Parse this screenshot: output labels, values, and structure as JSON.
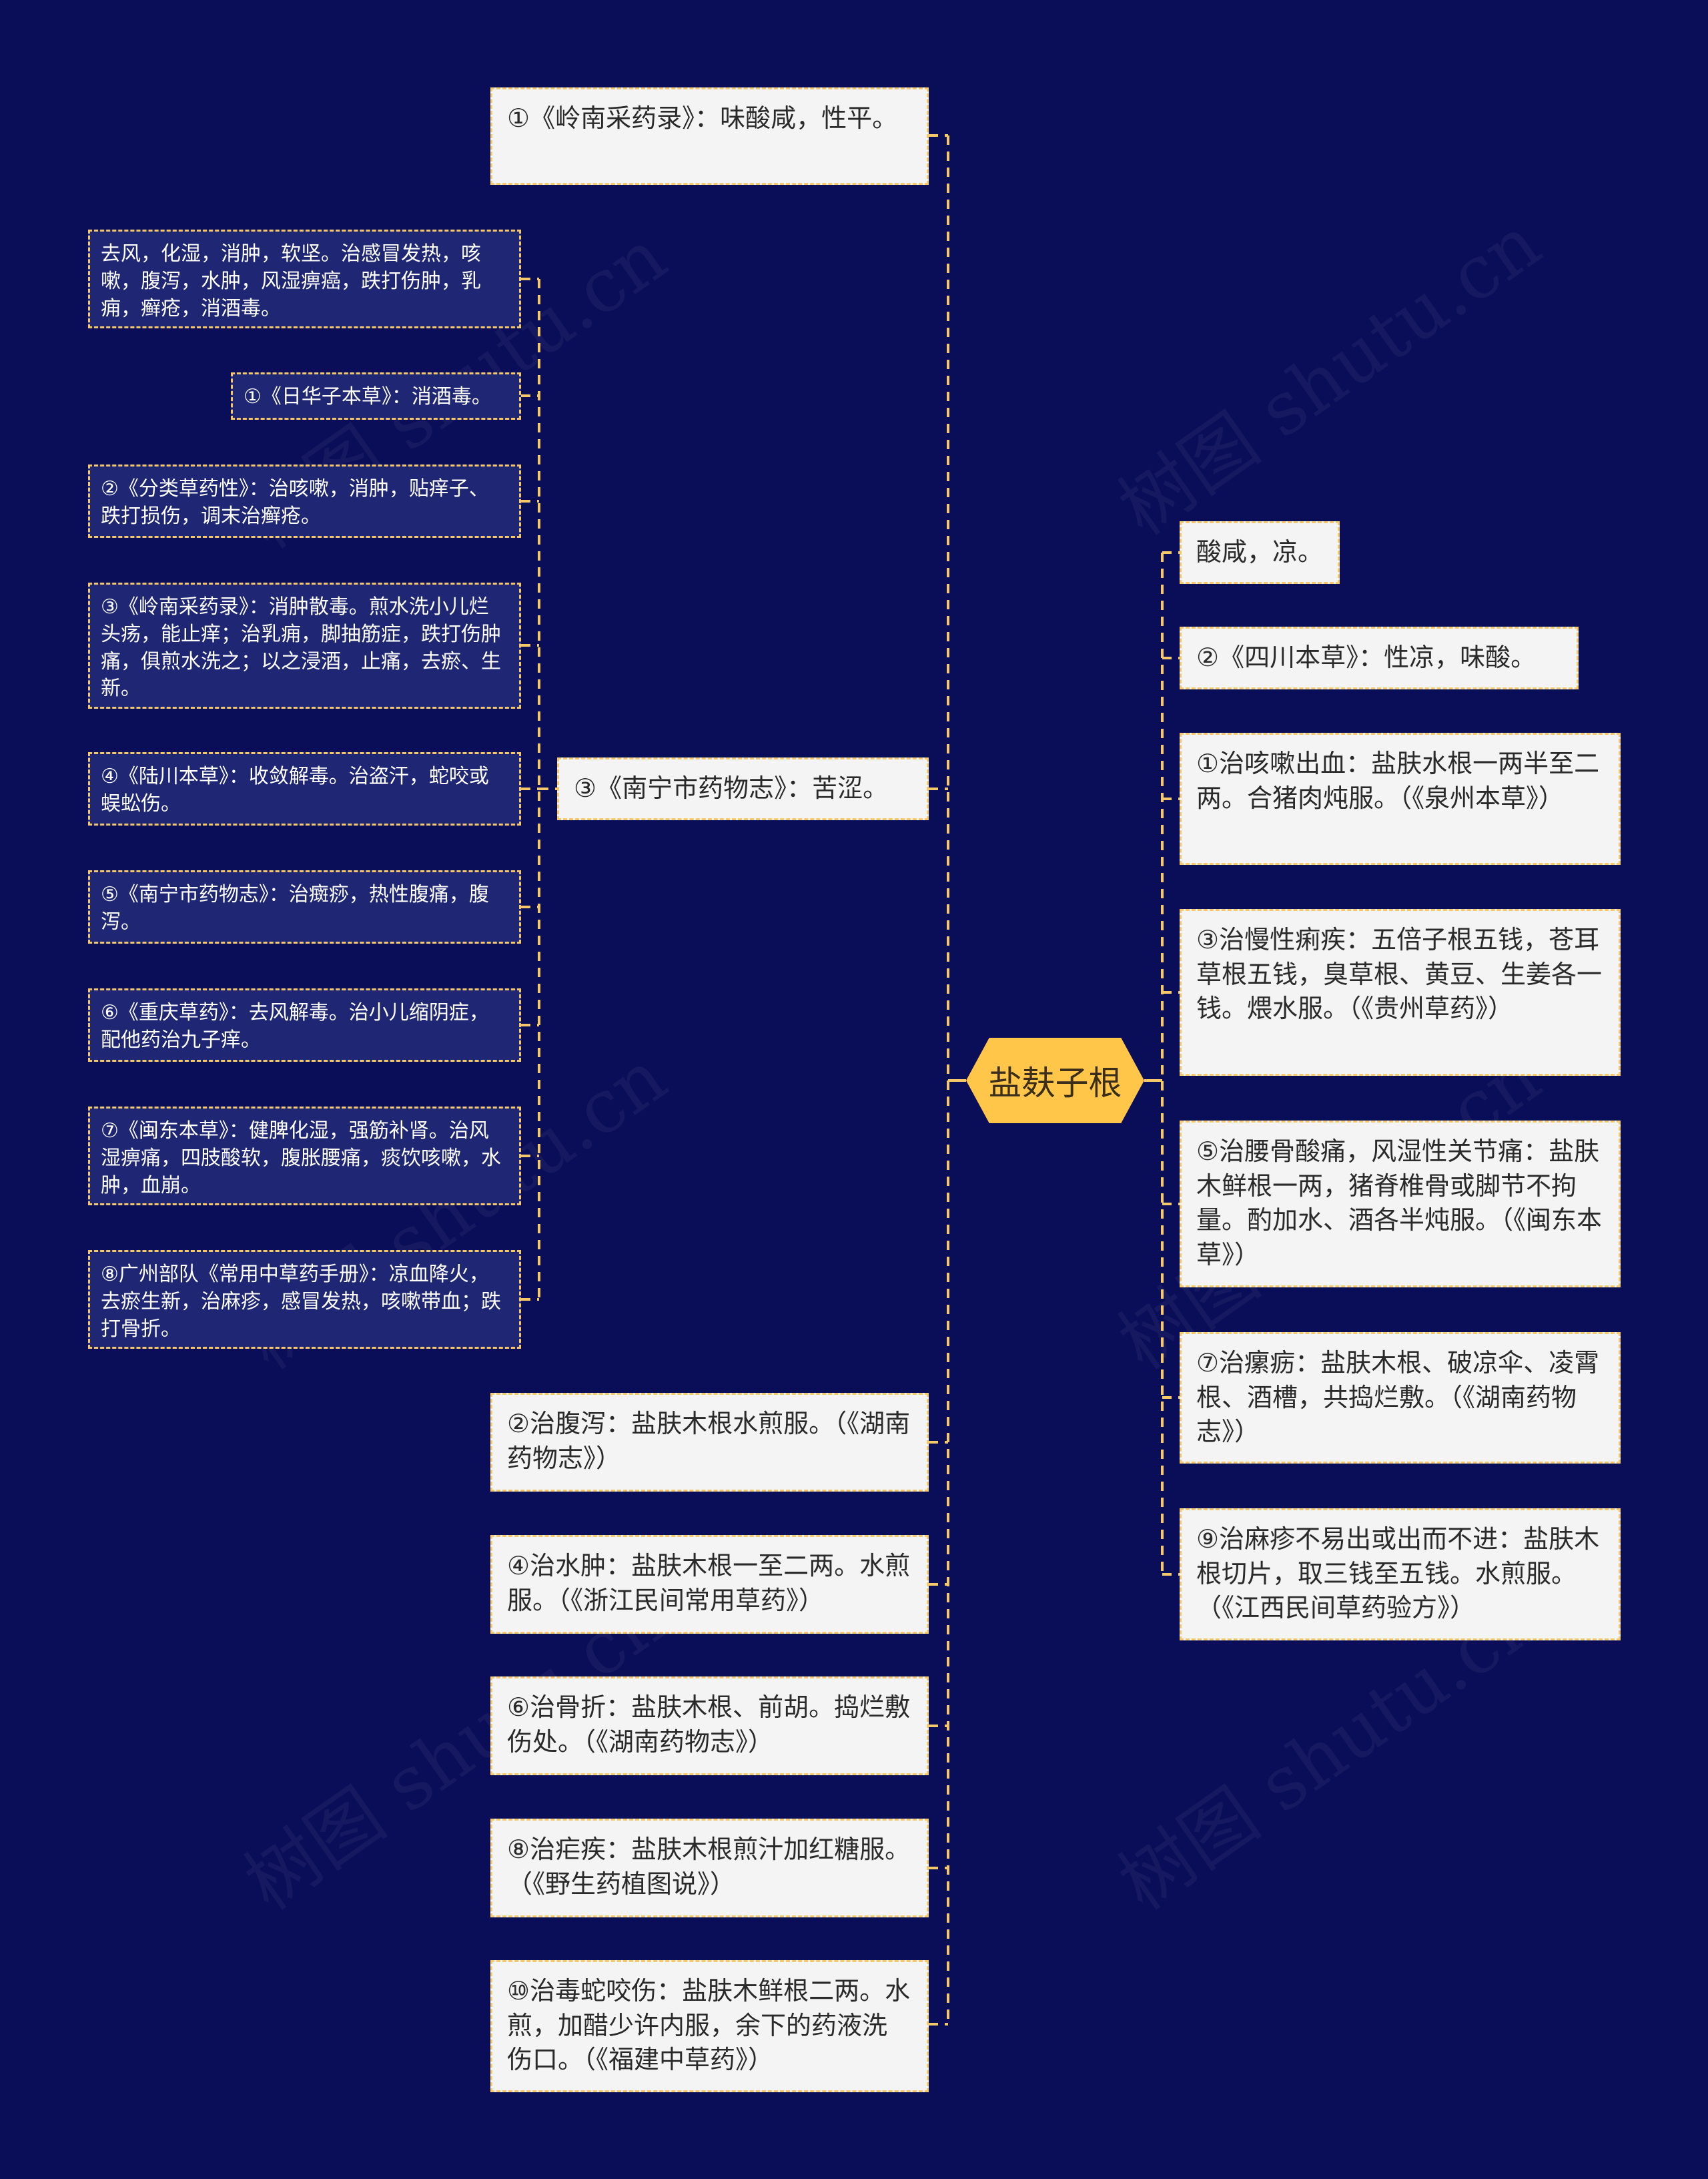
{
  "title": "盐麸子根",
  "watermark": "树图 shutu.cn",
  "colors": {
    "background": "#0a0d58",
    "root_fill": "#ffc64a",
    "connector": "#f5c96a",
    "light_node_fill": "#f4f4f4",
    "dark_node_fill": "#1f2674"
  },
  "left_branches": {
    "mid_nodes": [
      {
        "text": "①《岭南采药录》：味酸咸，性平。"
      },
      {
        "text": "③《南宁市药物志》：苦涩。"
      },
      {
        "text": "②治腹泻：盐肤木根水煎服。（《湖南药物志》）"
      },
      {
        "text": "④治水肿：盐肤木根一至二两。水煎服。（《浙江民间常用草药》）"
      },
      {
        "text": "⑥治骨折：盐肤木根、前胡。捣烂敷伤处。（《湖南药物志》）"
      },
      {
        "text": "⑧治疟疾：盐肤木根煎汁加红糖服。（《野生药植图说》）"
      },
      {
        "text": "⑩治毒蛇咬伤：盐肤木鲜根二两。水煎，加醋少许内服，余下的药液洗伤口。（《福建中草药》）"
      }
    ],
    "leaf_nodes": [
      {
        "text": "去风，化湿，消肿，软坚。治感冒发热，咳嗽，腹泻，水肿，风湿痹癌，跌打伤肿，乳痈，癣疮，消酒毒。"
      },
      {
        "text": "①《日华子本草》：消酒毒。"
      },
      {
        "text": "②《分类草药性》：治咳嗽，消肿，贴痒子、跌打损伤，调末治癣疮。"
      },
      {
        "text": "③《岭南采药录》：消肿散毒。煎水洗小儿烂头疡，能止痒；治乳痈，脚抽筋症，跌打伤肿痛，俱煎水洗之；以之浸酒，止痛，去瘀、生新。"
      },
      {
        "text": "④《陆川本草》：收敛解毒。治盗汗，蛇咬或蜈蚣伤。"
      },
      {
        "text": "⑤《南宁市药物志》：治癍痧，热性腹痛，腹泻。"
      },
      {
        "text": "⑥《重庆草药》：去风解毒。治小儿缩阴症，配他药治九子痒。"
      },
      {
        "text": "⑦《闽东本草》：健脾化湿，强筋补肾。治风湿痹痛，四肢酸软，腹胀腰痛，痰饮咳嗽，水肿，血崩。"
      },
      {
        "text": "⑧广州部队《常用中草药手册》：凉血降火，去瘀生新，治麻疹，感冒发热，咳嗽带血；跌打骨折。"
      }
    ]
  },
  "right_branches": {
    "nodes": [
      {
        "text": "酸咸，凉。"
      },
      {
        "text": "②《四川本草》：性凉，味酸。"
      },
      {
        "text": "①治咳嗽出血：盐肤水根一两半至二两。合猪肉炖服。（《泉州本草》）"
      },
      {
        "text": "③治慢性痢疾：五倍子根五钱，苍耳草根五钱，臭草根、黄豆、生姜各一钱。煨水服。（《贵州草药》）"
      },
      {
        "text": "⑤治腰骨酸痛，风湿性关节痛：盐肤木鲜根一两，猪脊椎骨或脚节不拘量。酌加水、酒各半炖服。（《闽东本草》）"
      },
      {
        "text": "⑦治瘰疬：盐肤木根、破凉伞、凌霄根、酒槽，共捣烂敷。（《湖南药物志》）"
      },
      {
        "text": "⑨治麻疹不易出或出而不进：盐肤木根切片，取三钱至五钱。水煎服。（《江西民间草药验方》）"
      }
    ]
  }
}
